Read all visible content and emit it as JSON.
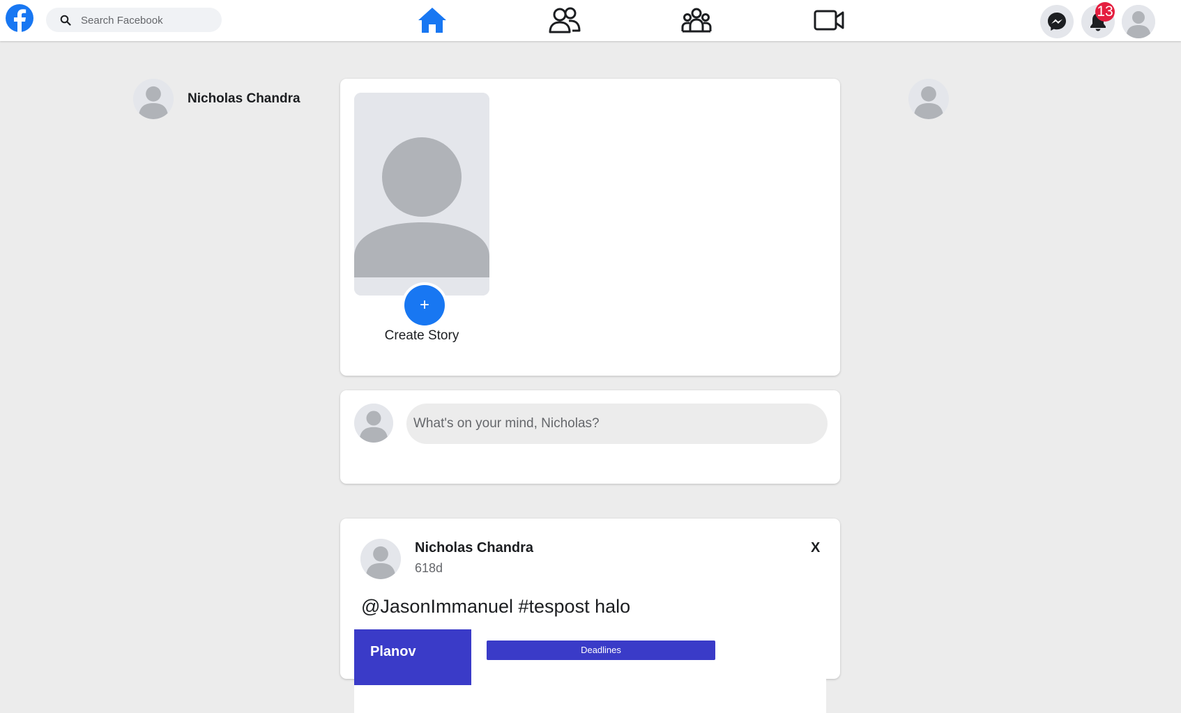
{
  "colors": {
    "brand_blue": "#1877f2",
    "background": "#ececec",
    "badge_red": "#e41e3f",
    "planov_purple": "#3a3bc8"
  },
  "header": {
    "logo_icon": "facebook-logo-icon",
    "search": {
      "placeholder": "Search Facebook",
      "icon": "search-icon"
    },
    "nav": [
      {
        "name": "home",
        "icon": "home-icon",
        "active": true
      },
      {
        "name": "friends",
        "icon": "friends-icon",
        "active": false
      },
      {
        "name": "groups",
        "icon": "groups-icon",
        "active": false
      },
      {
        "name": "watch",
        "icon": "video-icon",
        "active": false
      }
    ],
    "messenger_icon": "messenger-icon",
    "notifications": {
      "icon": "bell-icon",
      "count": "13"
    },
    "account_icon": "avatar-icon"
  },
  "left_sidebar": {
    "user_name": "Nicholas Chandra"
  },
  "stories": {
    "create_label": "Create Story",
    "plus_label": "+"
  },
  "composer": {
    "placeholder": "What's on your mind, Nicholas?"
  },
  "post": {
    "author": "Nicholas Chandra",
    "time": "618d",
    "close_label": "X",
    "text": "@JasonImmanuel #tespost halo",
    "image": {
      "brand": "Planov",
      "bar_label": "Deadlines"
    }
  }
}
